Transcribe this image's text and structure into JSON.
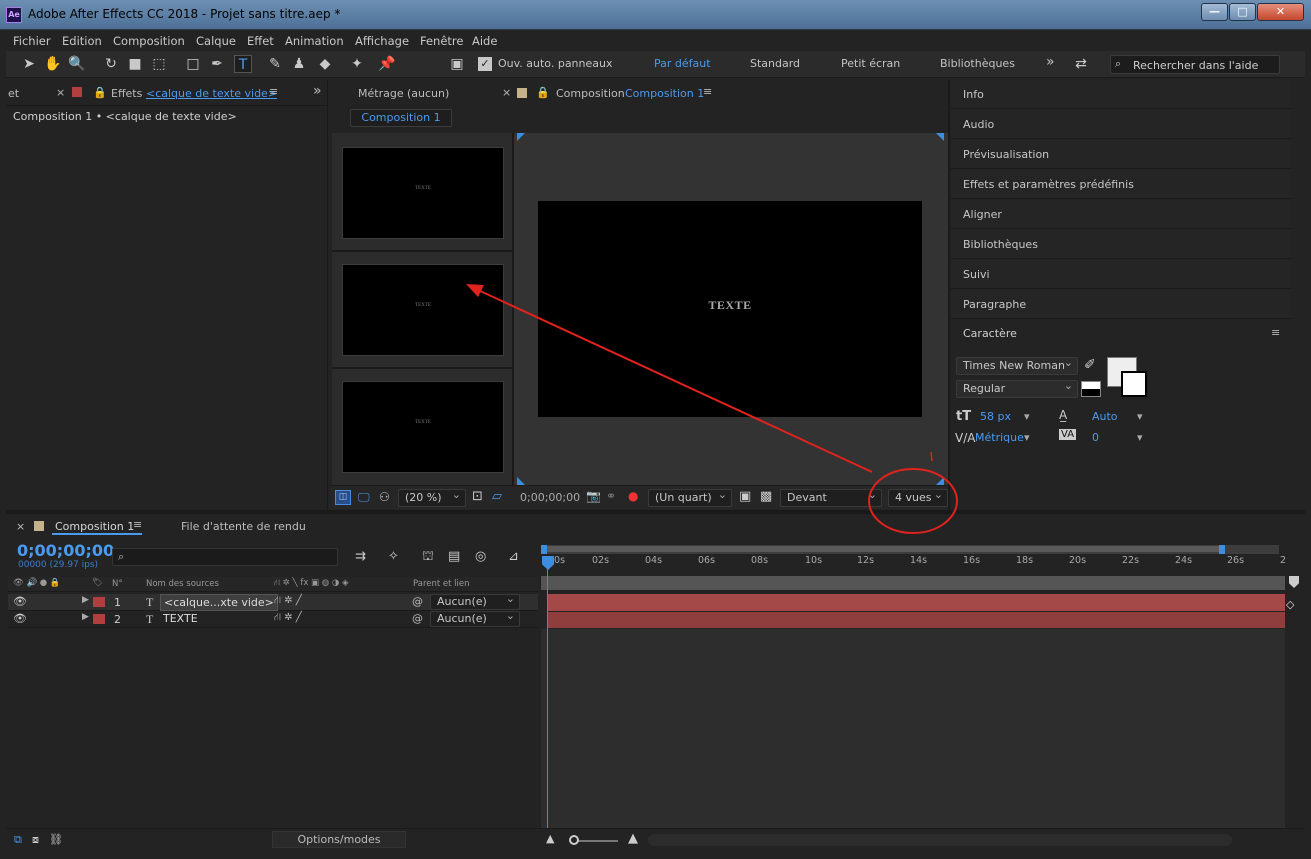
{
  "window": {
    "title": "Adobe After Effects CC 2018 - Projet sans titre.aep *",
    "logo": "Ae",
    "min": "—",
    "max": "□",
    "close": "✕"
  },
  "menu": [
    "Fichier",
    "Edition",
    "Composition",
    "Calque",
    "Effet",
    "Animation",
    "Affichage",
    "Fenêtre",
    "Aide"
  ],
  "toolbar": {
    "auto_panels": "Ouv. auto. panneaux",
    "workspaces": [
      "Par défaut",
      "Standard",
      "Petit écran",
      "Bibliothèques"
    ],
    "more": "»",
    "search_placeholder": "Rechercher dans l'aide"
  },
  "left_panel": {
    "tab_partial": "et",
    "tab_effects": "Effets",
    "tab_layer": "<calque de texte vide>",
    "more": "»",
    "breadcrumb": "Composition 1 • <calque de texte vide>"
  },
  "viewer": {
    "footage_tab": "Métrage",
    "footage_value": "(aucun)",
    "comp_tab_label": "Composition",
    "comp_tab_name": "Composition 1",
    "comp_button": "Composition 1",
    "thumb_text": "TEXTE",
    "main_text": "TEXTE",
    "zoom": "(20 %)",
    "timecode": "0;00;00;00",
    "resolution": "(Un quart)",
    "view": "Devant",
    "layout": "4 vues"
  },
  "right_panel": {
    "items": [
      "Info",
      "Audio",
      "Prévisualisation",
      "Effets et paramètres prédéfinis",
      "Aligner",
      "Bibliothèques",
      "Suivi",
      "Paragraphe"
    ],
    "character": {
      "title": "Caractère",
      "font": "Times New Roman",
      "style": "Regular",
      "size": "58 px",
      "leading": "Auto",
      "kerning": "Métrique",
      "tracking": "0"
    }
  },
  "timeline": {
    "tab": "Composition 1",
    "render_queue": "File d'attente de rendu",
    "timecode": "0;00;00;00",
    "frames": "00000 (29.97 ips)",
    "columns": {
      "num": "N°",
      "source": "Nom des sources",
      "parent": "Parent et lien"
    },
    "layers": [
      {
        "num": "1",
        "type": "T",
        "name": "<calque...xte vide>",
        "parent": "Aucun(e)"
      },
      {
        "num": "2",
        "type": "T",
        "name": "TEXTE",
        "parent": "Aucun(e)"
      }
    ],
    "ruler": [
      "00s",
      "02s",
      "04s",
      "06s",
      "08s",
      "10s",
      "12s",
      "14s",
      "16s",
      "18s",
      "20s",
      "22s",
      "24s",
      "26s",
      "2"
    ],
    "options": "Options/modes"
  },
  "colors": {
    "accent": "#4a9bf0",
    "layer": "#b13f3f",
    "annotation": "#e0231d"
  }
}
